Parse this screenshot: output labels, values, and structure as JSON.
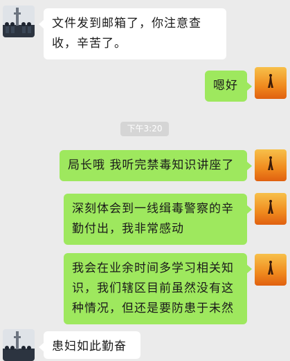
{
  "chat": {
    "timestamp": "下午3:20",
    "messages": [
      {
        "side": "left",
        "text": "文件发到邮箱了，你注意查收，辛苦了。"
      },
      {
        "side": "right",
        "text": "嗯好"
      },
      {
        "side": "right",
        "text": "局长哦 我听完禁毒知识讲座了"
      },
      {
        "side": "right",
        "text": "深刻体会到一线缉毒警察的辛勤付出，我非常感动"
      },
      {
        "side": "right",
        "text": "我会在业余时间多学习相关知识，我们辖区目前虽然没有这种情况，但还是要防患于未然"
      },
      {
        "side": "left",
        "text": "患妇如此勤奋"
      }
    ]
  },
  "colors": {
    "background": "#ebebeb",
    "bubble_incoming": "#ffffff",
    "bubble_outgoing": "#9ee85e",
    "timestamp_bg": "#d5d5d5"
  },
  "icons": {
    "contact_avatar": "police-parade-avatar-icon",
    "self_avatar": "sunset-figure-avatar-icon"
  }
}
